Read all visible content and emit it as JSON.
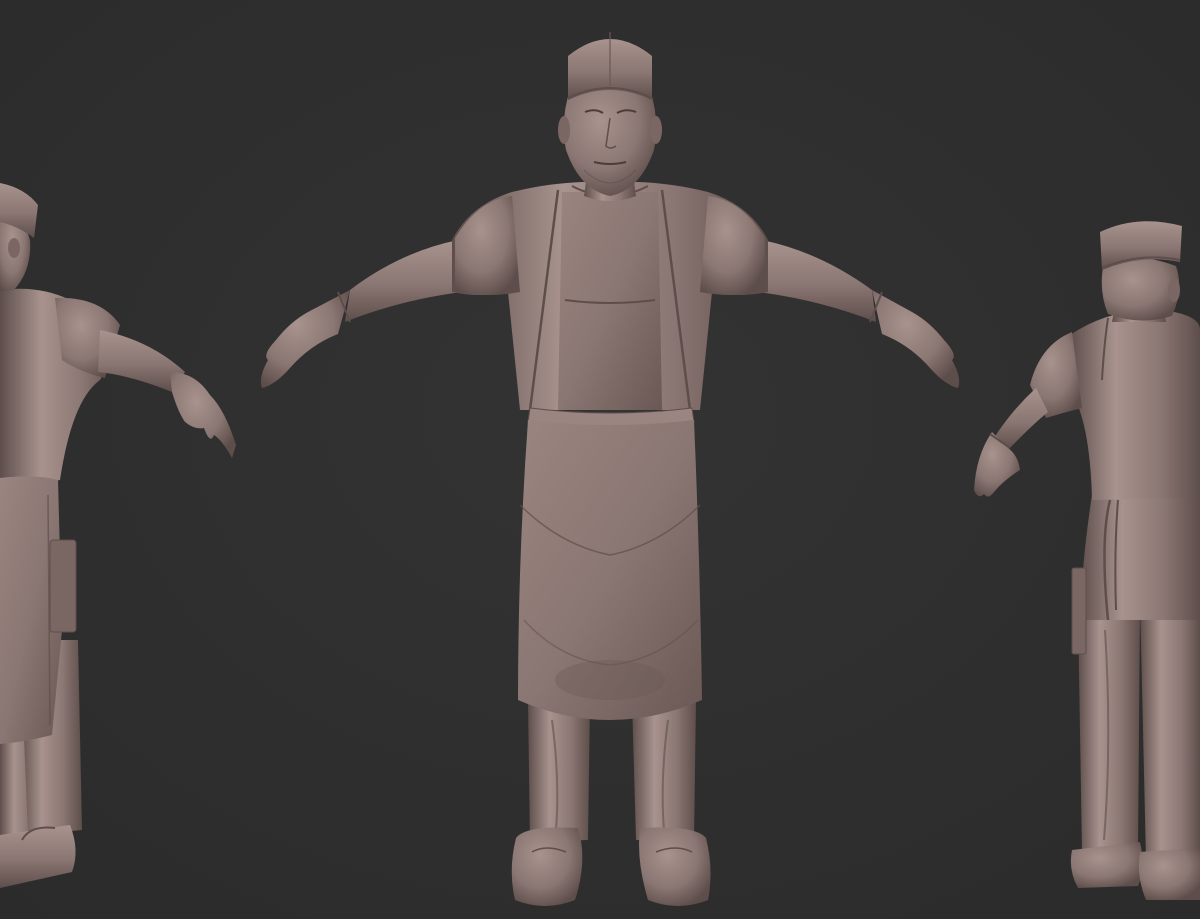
{
  "viewport": {
    "background_color": "#333333",
    "background_vignette": "#2b2b2b",
    "clay_color": "#8a7672",
    "clay_highlight": "#a8938e",
    "clay_shadow": "#5e4e4b",
    "clay_deep": "#4a3d3a"
  },
  "models": [
    {
      "id": "side-view",
      "view": "side"
    },
    {
      "id": "front-view",
      "view": "front"
    },
    {
      "id": "back-view",
      "view": "back"
    }
  ]
}
